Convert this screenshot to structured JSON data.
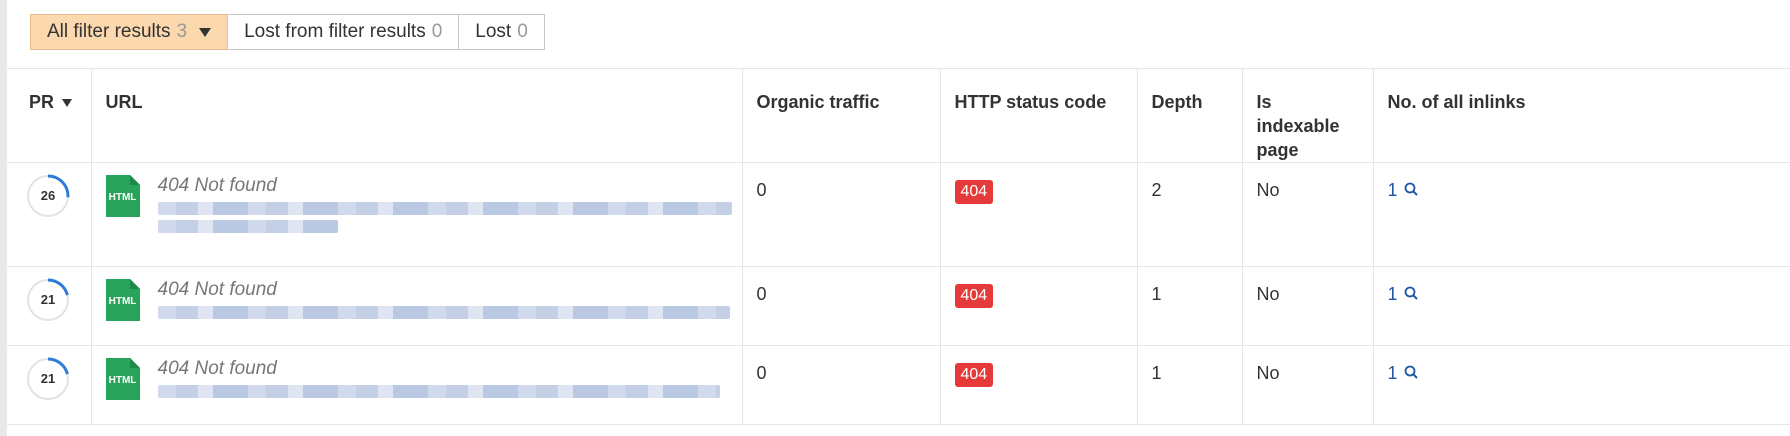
{
  "filter_tabs": [
    {
      "label": "All filter results",
      "count": "3",
      "active": true
    },
    {
      "label": "Lost from filter results",
      "count": "0",
      "active": false
    },
    {
      "label": "Lost",
      "count": "0",
      "active": false
    }
  ],
  "table": {
    "columns": [
      "PR",
      "URL",
      "Organic traffic",
      "HTTP status code",
      "Depth",
      "Is indexable page",
      "No. of all inlinks"
    ],
    "rows": [
      {
        "pr": "26",
        "pr_fraction": 0.26,
        "file_type": "HTML",
        "url_title": "404 Not found",
        "organic_traffic": "0",
        "http_status": "404",
        "depth": "2",
        "indexable": "No",
        "inlinks": "1"
      },
      {
        "pr": "21",
        "pr_fraction": 0.21,
        "file_type": "HTML",
        "url_title": "404 Not found",
        "organic_traffic": "0",
        "http_status": "404",
        "depth": "1",
        "indexable": "No",
        "inlinks": "1"
      },
      {
        "pr": "21",
        "pr_fraction": 0.21,
        "file_type": "HTML",
        "url_title": "404 Not found",
        "organic_traffic": "0",
        "http_status": "404",
        "depth": "1",
        "indexable": "No",
        "inlinks": "1"
      }
    ]
  },
  "colors": {
    "active_tab": "#fbd8ad",
    "status_badge": "#e63a3a",
    "html_icon": "#27a35a",
    "pr_arc": "#2f7bd8",
    "link": "#2156a6"
  },
  "icons": {
    "sort": "caret-down-icon",
    "file": "html-file-icon",
    "search": "magnifier-icon"
  }
}
